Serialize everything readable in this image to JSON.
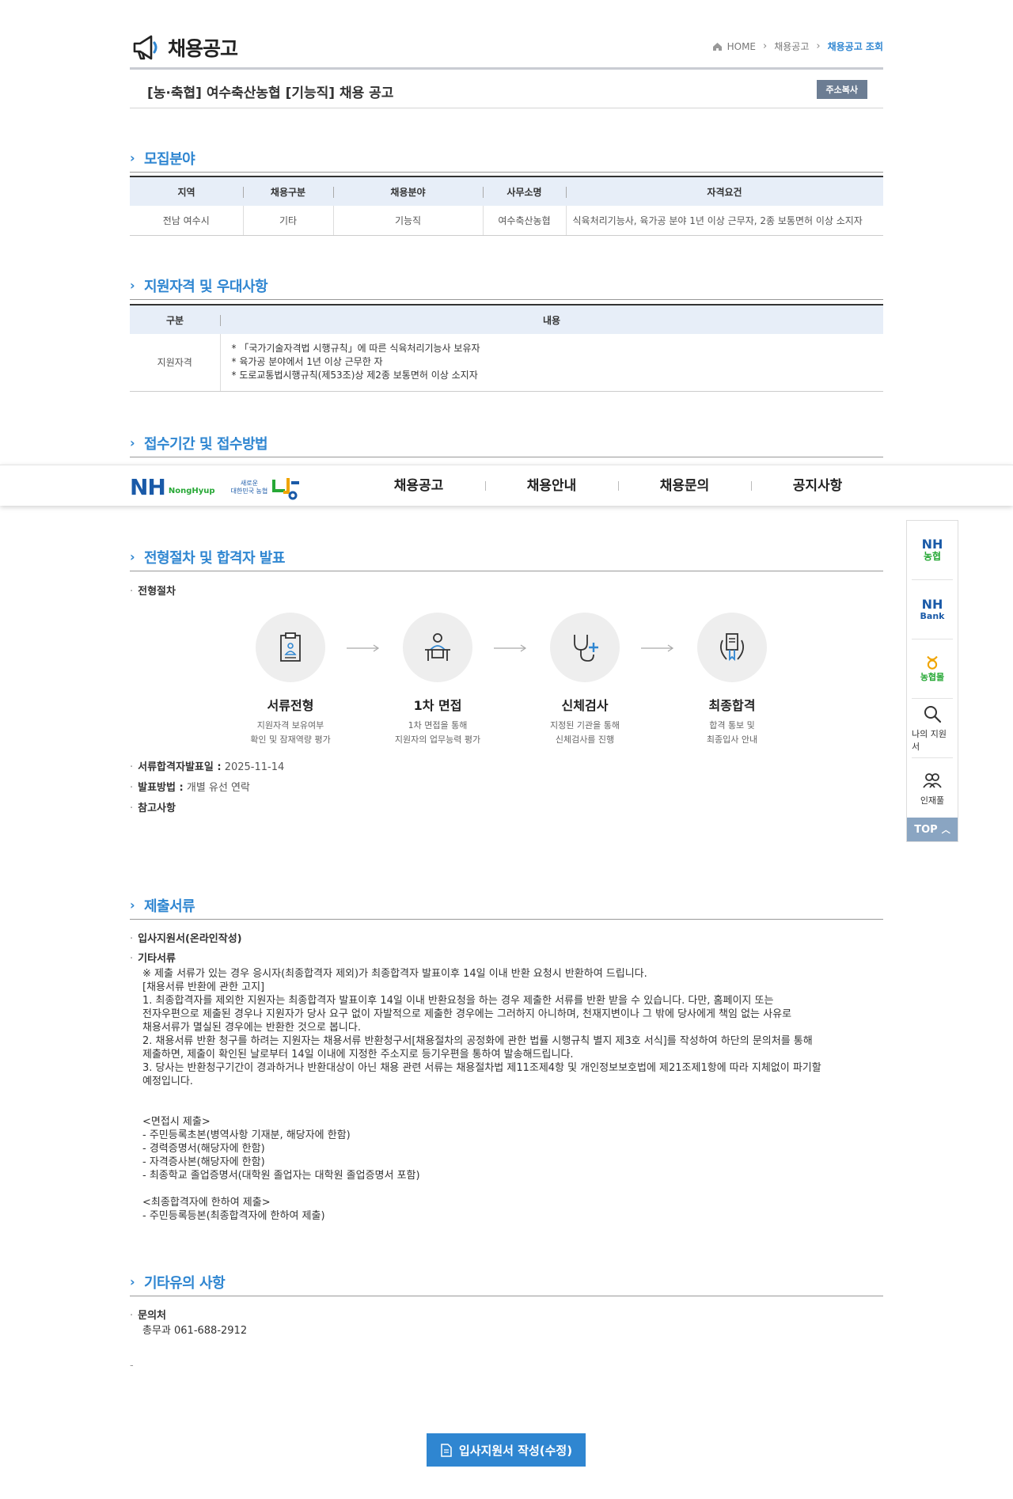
{
  "header": {
    "title": "채용공고",
    "breadcrumb": [
      "HOME",
      "채용공고",
      "채용공고 조회"
    ]
  },
  "posting": {
    "title": "[농·축협] 여수축산농협 [기능직] 채용 공고",
    "copy_label": "주소복사"
  },
  "sections": {
    "recruit": "모집분야",
    "qualification": "지원자격 및 우대사항",
    "reception": "접수기간 및 접수방법",
    "process": "전형절차 및 합격자 발표",
    "documents": "제출서류",
    "etc": "기타유의 사항"
  },
  "recruit_table": {
    "headers": [
      "지역",
      "채용구분",
      "채용분야",
      "사무소명",
      "자격요건"
    ],
    "row": [
      "전남 여수시",
      "기타",
      "기능직",
      "여수축산농협",
      "식육처리기능사, 육가공 분야 1년 이상 근무자, 2종 보통면허 이상 소지자"
    ]
  },
  "qual_table": {
    "headers": [
      "구분",
      "내용"
    ],
    "row_label": "지원자격",
    "items": [
      "* 「국가기술자격법 시행규칙」에 따른 식육처리기능사 보유자",
      "* 육가공 분야에서 1년 이상 근무한 자",
      "* 도로교통법시행규칙(제53조)상 제2종 보통면허 이상 소지자"
    ]
  },
  "float_nav": {
    "logo": "NH",
    "logo_sub": "NongHyup",
    "slogan": "새로운\n대한민국 농협",
    "menu": [
      "채용공고",
      "채용안내",
      "채용문의",
      "공지사항"
    ]
  },
  "quick_menu": {
    "nh_line1": "NH",
    "nh_line2": "농협",
    "bank_line1": "NH",
    "bank_line2": "Bank",
    "mall": "농협몰",
    "my_apply": "나의 지원서",
    "talent": "인재풀",
    "top": "TOP"
  },
  "process": {
    "label": "전형절차",
    "steps": [
      {
        "name": "서류전형",
        "desc": "지원자격 보유여부\n확인 및 잠재역량 평가"
      },
      {
        "name": "1차 면접",
        "desc": "1차 면접을 통해\n지원자의 업무능력 평가"
      },
      {
        "name": "신체검사",
        "desc": "지정된 기관을 통해\n신체검사를 진행"
      },
      {
        "name": "최종합격",
        "desc": "합격 통보 및\n최종입사 안내"
      }
    ],
    "result_date_label": "서류합격자발표일 :",
    "result_date": "2025-11-14",
    "method_label": "발표방법 :",
    "method": "개별 유선 연락",
    "note_label": "참고사항"
  },
  "documents": {
    "item1": "입사지원서(온라인작성)",
    "item2": "기타서류",
    "text": "※ 제출 서류가 있는 경우 응시자(최종합격자 제외)가 최종합격자 발표이후 14일 이내 반환 요청시 반환하여 드립니다.\n[채용서류 반환에 관한 고지]\n 1. 최종합격자를 제외한 지원자는 최종합격자 발표이후 14일 이내 반환요청을 하는 경우 제출한 서류를 반환 받을 수 있습니다. 다만, 홈페이지 또는\n전자우편으로 제출된 경우나 지원자가 당사 요구 없이 자발적으로 제출한 경우에는 그러하지 아니하며, 천재지변이나 그 밖에 당사에게 책임 없는 사유로\n채용서류가 멸실된 경우에는 반환한 것으로 봅니다.\n 2. 채용서류 반환 청구를 하려는 지원자는 채용서류 반환청구서[채용절차의 공정화에 관한 법률 시행규칙 별지 제3호 서식]를 작성하여 하단의 문의처를 통해\n제출하면, 제출이 확인된 날로부터 14일 이내에 지정한 주소지로 등기우편을 통하여 발송해드립니다.\n 3. 당사는 반환청구기간이 경과하거나 반환대상이 아닌 채용 관련 서류는 채용절차법 제11조제4항 및 개인정보보호법에 제21조제1항에 따라 지체없이 파기할\n예정입니다.\n\n\n <면접시 제출>\n- 주민등록초본(병역사항 기재분, 해당자에 한함)\n- 경력증명서(해당자에 한함)\n- 자격증사본(해당자에 한함)\n- 최종학교 졸업증명서(대학원 졸업자는 대학원 졸업증명서 포함)\n\n <최종합격자에 한하여 제출>\n- 주민등록등본(최종합격자에 한하여 제출)"
  },
  "etc": {
    "contact_label": "문의처",
    "contact": "총무과 061-688-2912",
    "dash": "-"
  },
  "apply_button": "입사지원서 작성(수정)",
  "colors": {
    "accent": "#2f86d1",
    "table_header": "#e7eef8",
    "nh_blue": "#1a5aa8",
    "nh_green": "#27a836"
  }
}
